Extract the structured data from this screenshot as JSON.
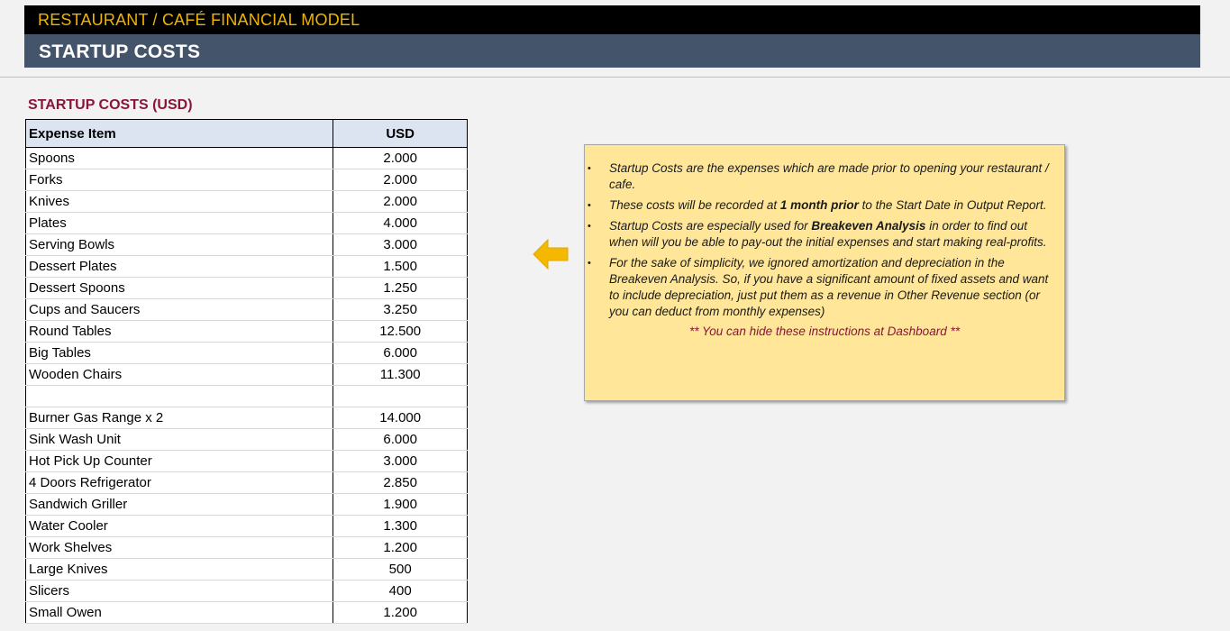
{
  "header": {
    "app_title": "RESTAURANT / CAFÉ FINANCIAL MODEL",
    "sheet_title": "STARTUP COSTS"
  },
  "section_title": "STARTUP COSTS (USD)",
  "table": {
    "columns": [
      "Expense Item",
      "USD"
    ],
    "rows": [
      [
        "Spoons",
        "2.000"
      ],
      [
        "Forks",
        "2.000"
      ],
      [
        "Knives",
        "2.000"
      ],
      [
        "Plates",
        "4.000"
      ],
      [
        "Serving Bowls",
        "3.000"
      ],
      [
        "Dessert Plates",
        "1.500"
      ],
      [
        "Dessert Spoons",
        "1.250"
      ],
      [
        "Cups and Saucers",
        "3.250"
      ],
      [
        "Round Tables",
        "12.500"
      ],
      [
        "Big Tables",
        "6.000"
      ],
      [
        "Wooden Chairs",
        "11.300"
      ],
      [
        "",
        ""
      ],
      [
        "Burner Gas Range x 2",
        "14.000"
      ],
      [
        "Sink Wash Unit",
        "6.000"
      ],
      [
        "Hot Pick Up Counter",
        "3.000"
      ],
      [
        "4 Doors Refrigerator",
        "2.850"
      ],
      [
        "Sandwich Griller",
        "1.900"
      ],
      [
        "Water Cooler",
        "1.300"
      ],
      [
        "Work Shelves",
        "1.200"
      ],
      [
        "Large Knives",
        "500"
      ],
      [
        "Slicers",
        "400"
      ],
      [
        "Small Owen",
        "1.200"
      ]
    ]
  },
  "instructions": {
    "bullet_1": "Startup Costs are the expenses which are made prior to opening your restaurant / cafe.",
    "bullet_2_pre": "These costs will be recorded at ",
    "bullet_2_bold": "1 month prior",
    "bullet_2_post": " to the Start Date in Output Report.",
    "bullet_3_pre": "Startup Costs are especially used for ",
    "bullet_3_bold": "Breakeven Analysis",
    "bullet_3_post": " in order to find out when will you be able to pay-out the initial expenses and start making real-profits.",
    "bullet_4": "For the sake of simplicity, we ignored amortization and depreciation in the Breakeven Analysis. So, if you have a significant amount of fixed assets and want to include depreciation, just put them as a revenue in Other Revenue section (or you can deduct from monthly expenses)",
    "footer": "** You can hide these instructions at Dashboard **"
  },
  "icons": {
    "arrow": "arrow-left-icon"
  },
  "colors": {
    "banner_black": "#000000",
    "banner_title_gold": "#f0b400",
    "banner_slate": "#44546a",
    "section_title_maroon": "#8b1538",
    "table_header_fill": "#dce3f1",
    "note_fill": "#ffe699",
    "arrow_fill": "#f5b800"
  }
}
